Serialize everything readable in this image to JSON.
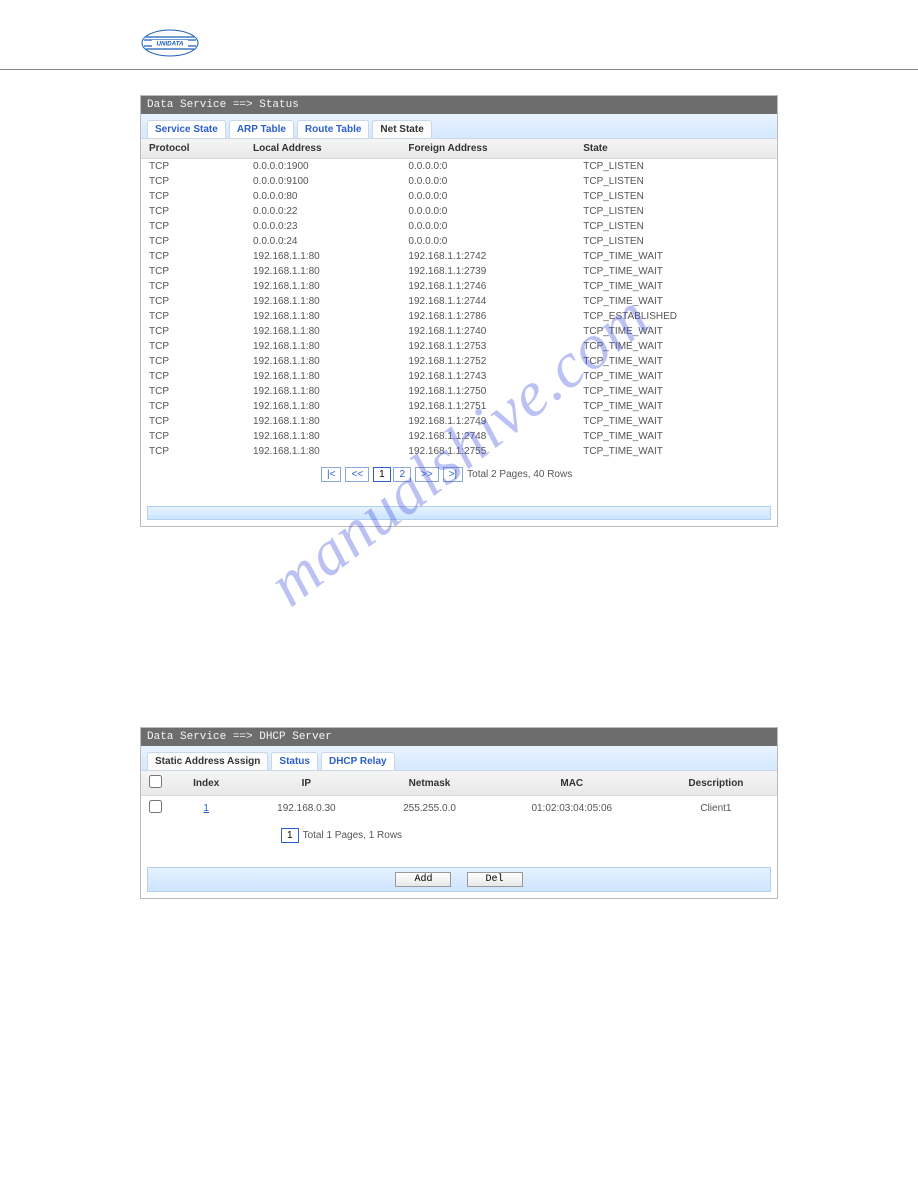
{
  "logo_text": "UNIDATA",
  "watermark": "manualshive.com",
  "panel1": {
    "title": "Data Service ==> Status",
    "tabs": [
      {
        "label": "Service State",
        "active": false
      },
      {
        "label": "ARP Table",
        "active": false
      },
      {
        "label": "Route Table",
        "active": false
      },
      {
        "label": "Net State",
        "active": true
      }
    ],
    "columns": [
      "Protocol",
      "Local Address",
      "Foreign Address",
      "State"
    ],
    "rows": [
      [
        "TCP",
        "0.0.0.0:1900",
        "0.0.0.0:0",
        "TCP_LISTEN"
      ],
      [
        "TCP",
        "0.0.0.0:9100",
        "0.0.0.0:0",
        "TCP_LISTEN"
      ],
      [
        "TCP",
        "0.0.0.0:80",
        "0.0.0.0:0",
        "TCP_LISTEN"
      ],
      [
        "TCP",
        "0.0.0.0:22",
        "0.0.0.0:0",
        "TCP_LISTEN"
      ],
      [
        "TCP",
        "0.0.0.0:23",
        "0.0.0.0:0",
        "TCP_LISTEN"
      ],
      [
        "TCP",
        "0.0.0.0:24",
        "0.0.0.0:0",
        "TCP_LISTEN"
      ],
      [
        "TCP",
        "192.168.1.1:80",
        "192.168.1.1:2742",
        "TCP_TIME_WAIT"
      ],
      [
        "TCP",
        "192.168.1.1:80",
        "192.168.1.1:2739",
        "TCP_TIME_WAIT"
      ],
      [
        "TCP",
        "192.168.1.1:80",
        "192.168.1.1:2746",
        "TCP_TIME_WAIT"
      ],
      [
        "TCP",
        "192.168.1.1:80",
        "192.168.1.1:2744",
        "TCP_TIME_WAIT"
      ],
      [
        "TCP",
        "192.168.1.1:80",
        "192.168.1.1:2786",
        "TCP_ESTABLISHED"
      ],
      [
        "TCP",
        "192.168.1.1:80",
        "192.168.1.1:2740",
        "TCP_TIME_WAIT"
      ],
      [
        "TCP",
        "192.168.1.1:80",
        "192.168.1.1:2753",
        "TCP_TIME_WAIT"
      ],
      [
        "TCP",
        "192.168.1.1:80",
        "192.168.1.1:2752",
        "TCP_TIME_WAIT"
      ],
      [
        "TCP",
        "192.168.1.1:80",
        "192.168.1.1:2743",
        "TCP_TIME_WAIT"
      ],
      [
        "TCP",
        "192.168.1.1:80",
        "192.168.1.1:2750",
        "TCP_TIME_WAIT"
      ],
      [
        "TCP",
        "192.168.1.1:80",
        "192.168.1.1:2751",
        "TCP_TIME_WAIT"
      ],
      [
        "TCP",
        "192.168.1.1:80",
        "192.168.1.1:2749",
        "TCP_TIME_WAIT"
      ],
      [
        "TCP",
        "192.168.1.1:80",
        "192.168.1.1:2748",
        "TCP_TIME_WAIT"
      ],
      [
        "TCP",
        "192.168.1.1:80",
        "192.168.1.1:2755",
        "TCP_TIME_WAIT"
      ]
    ],
    "pager": {
      "first": "|<",
      "prev": "<<",
      "pages": [
        "1",
        "2"
      ],
      "current": "1",
      "next": ">>",
      "last": ">|",
      "summary": "Total 2 Pages, 40 Rows"
    }
  },
  "panel2": {
    "title": "Data Service ==> DHCP Server",
    "tabs": [
      {
        "label": "Static Address Assign",
        "active": true
      },
      {
        "label": "Status",
        "active": false
      },
      {
        "label": "DHCP Relay",
        "active": false
      }
    ],
    "columns": [
      "",
      "Index",
      "IP",
      "Netmask",
      "MAC",
      "Description"
    ],
    "rows": [
      {
        "index": "1",
        "ip": "192.168.0.30",
        "netmask": "255.255.0.0",
        "mac": "01:02:03:04:05:06",
        "desc": "Client1"
      }
    ],
    "pager": {
      "page": "1",
      "summary": "Total 1 Pages, 1 Rows"
    },
    "buttons": {
      "add": "Add",
      "del": "Del"
    }
  }
}
